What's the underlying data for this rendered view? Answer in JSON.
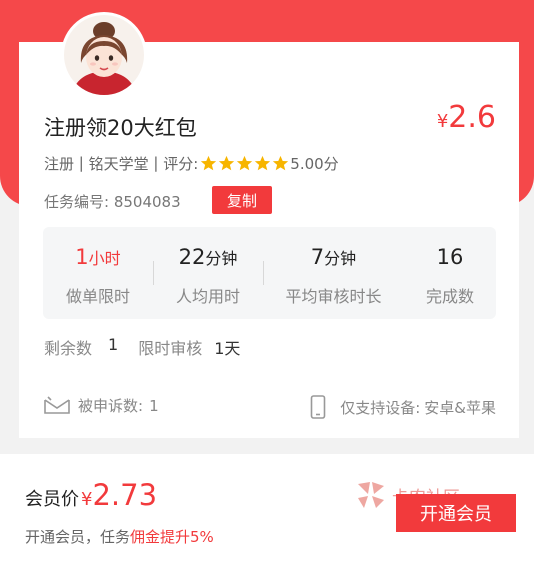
{
  "task": {
    "title": "注册领20大红包",
    "price_currency": "¥",
    "price": "2.6",
    "category": "注册",
    "author": "铭天学堂",
    "rating_label": "评分:",
    "rating": "5.00分",
    "stars": 5,
    "task_no_label": "任务编号:",
    "task_no": "8504083",
    "copy_label": "复制"
  },
  "stats": [
    {
      "value": "1",
      "unit": "小时",
      "label": "做单限时",
      "highlight": true
    },
    {
      "value": "22",
      "unit": "分钟",
      "label": "人均用时",
      "highlight": false
    },
    {
      "value": "7",
      "unit": "分钟",
      "label": "平均审核时长",
      "highlight": false
    },
    {
      "value": "16",
      "unit": "",
      "label": "完成数",
      "highlight": false
    }
  ],
  "remain": {
    "remain_label": "剩余数",
    "remain_value": "1",
    "review_label": "限时审核",
    "review_value": "1天"
  },
  "complaint": {
    "label": "被申诉数:",
    "value": "1",
    "icon": "envelope-icon"
  },
  "device": {
    "label": "仅支持设备:",
    "value": "安卓&苹果",
    "icon": "phone-icon"
  },
  "member": {
    "price_label": "会员价",
    "currency": "¥",
    "price": "2.73",
    "promo_prefix": "开通会员，任务",
    "promo_highlight": "佣金提升5%",
    "open_button": "开通会员"
  },
  "watermark": {
    "text": "卡农社区"
  },
  "colors": {
    "brand_red": "#f5484a",
    "price_red": "#f23a3c",
    "star": "#f7b500"
  }
}
